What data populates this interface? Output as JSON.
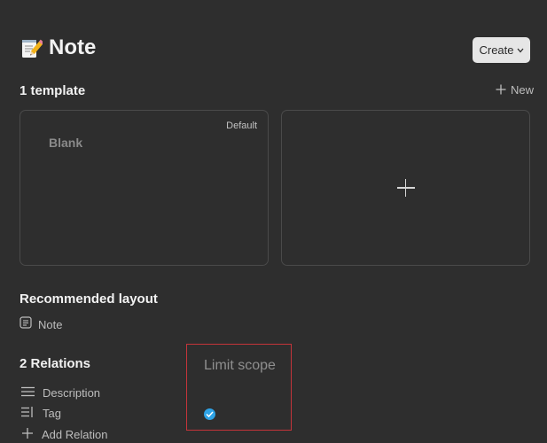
{
  "header": {
    "title": "Note",
    "title_icon": "memo-icon",
    "create_label": "Create"
  },
  "templates": {
    "section_title": "1 template",
    "new_label": "New",
    "cards": [
      {
        "name": "Blank",
        "badge": "Default"
      }
    ]
  },
  "layout": {
    "section_title": "Recommended layout",
    "value": "Note",
    "icon": "document-icon"
  },
  "relations": {
    "section_title": "2 Relations",
    "items": [
      {
        "label": "Description",
        "icon": "text-lines-icon"
      },
      {
        "label": "Tag",
        "icon": "tag-list-icon"
      }
    ],
    "add_label": "Add Relation"
  },
  "scope": {
    "title": "Limit scope",
    "checked": true,
    "check_color": "#2ea3e6",
    "box_color": "#c4343a"
  }
}
